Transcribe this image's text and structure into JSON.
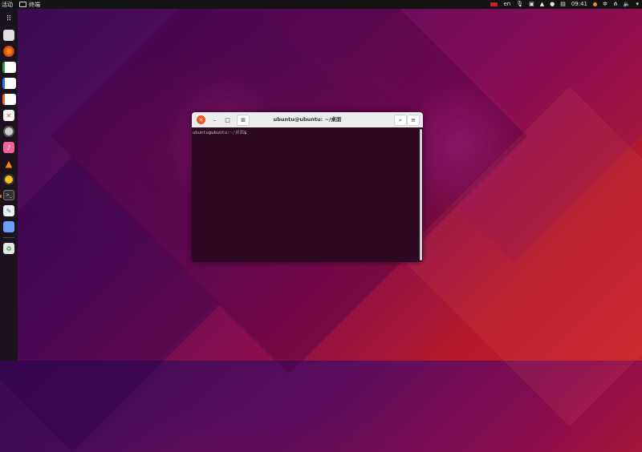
{
  "topbar": {
    "activities": "活动",
    "app_menu": "终端",
    "clock": "09:41",
    "input_method": "en"
  },
  "dock": {
    "items": [
      {
        "name": "show-apps",
        "icon": "grid-icon"
      },
      {
        "name": "files",
        "icon": "folder-icon"
      },
      {
        "name": "firefox",
        "icon": "firefox-icon"
      },
      {
        "name": "libreoffice-calc",
        "icon": "spreadsheet-icon"
      },
      {
        "name": "libreoffice-writer",
        "icon": "document-icon"
      },
      {
        "name": "libreoffice-impress",
        "icon": "presentation-icon"
      },
      {
        "name": "software",
        "icon": "store-icon"
      },
      {
        "name": "disks",
        "icon": "disk-icon"
      },
      {
        "name": "music",
        "icon": "music-icon"
      },
      {
        "name": "vlc",
        "icon": "cone-icon"
      },
      {
        "name": "rhythmbox",
        "icon": "speaker-icon"
      },
      {
        "name": "terminal",
        "icon": "terminal-icon"
      },
      {
        "name": "text-editor",
        "icon": "pencil-icon"
      },
      {
        "name": "settings-app",
        "icon": "blue-app-icon"
      },
      {
        "name": "trash",
        "icon": "trash-icon"
      }
    ]
  },
  "terminal": {
    "title": "ubuntu@ubuntu: ~/桌面",
    "prompt_user": "ubuntu@ubuntu",
    "prompt_dir": ":~/桌面",
    "prompt_symbol": "$"
  },
  "colors": {
    "accent": "#e95420",
    "terminal_bg": "#2d0a22",
    "topbar_bg": "#131313"
  }
}
